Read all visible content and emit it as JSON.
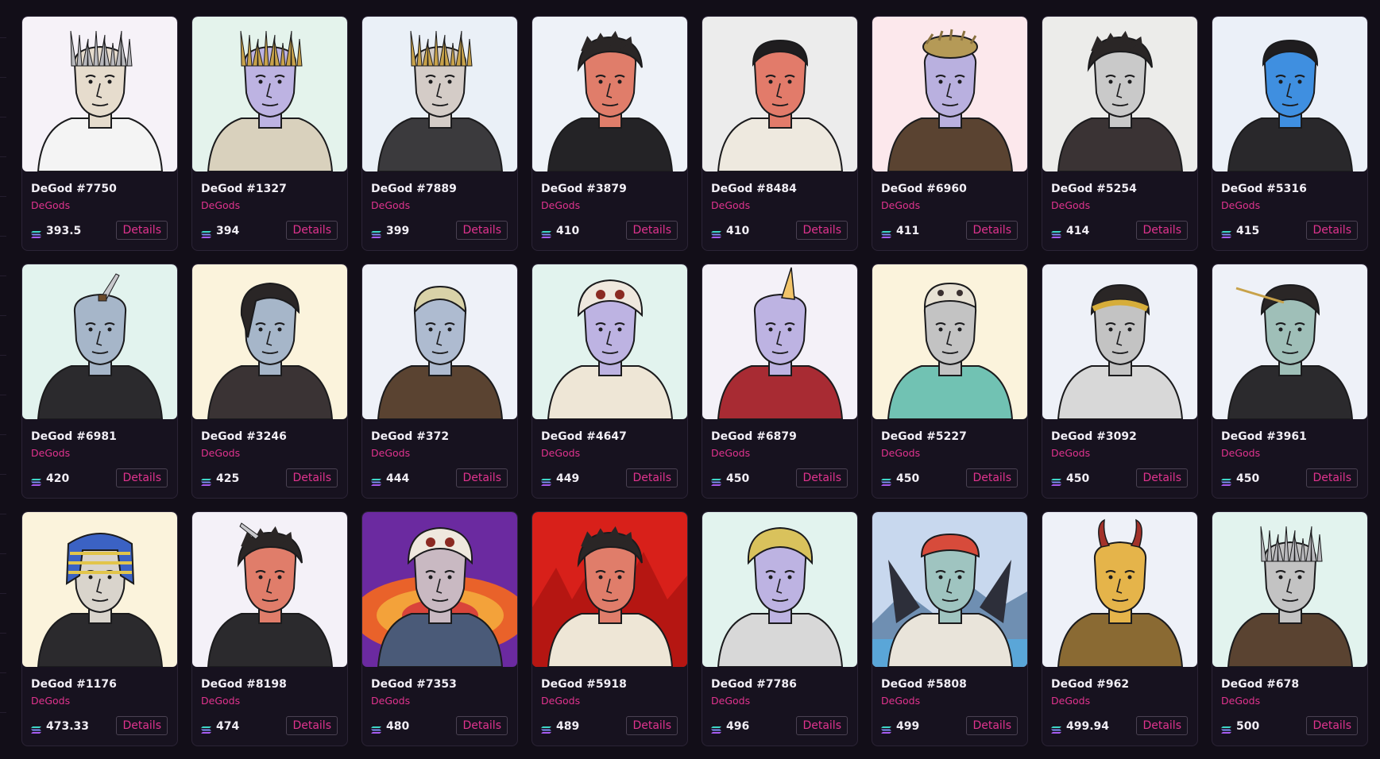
{
  "theme": {
    "page_bg": "#120e18",
    "card_bg": "#17121f",
    "accent": "#e0338e",
    "text": "#f1eef5",
    "sol_gradient": [
      "#9945ff",
      "#14f195"
    ]
  },
  "grid": {
    "details_label": "Details",
    "cards": [
      {
        "name": "DeGod #7750",
        "collection": "DeGods",
        "price": "393.5",
        "bg": "#f6f2f8",
        "skin": "#e6dccd",
        "hair": "spikes-silver",
        "outfit": "#f4f4f4"
      },
      {
        "name": "DeGod #1327",
        "collection": "DeGods",
        "price": "394",
        "bg": "#e4f3ec",
        "skin": "#bdb3e2",
        "hair": "spikes-gold",
        "outfit": "#d9d1bd"
      },
      {
        "name": "DeGod #7889",
        "collection": "DeGods",
        "price": "399",
        "bg": "#eaf0f7",
        "skin": "#d4ccc7",
        "hair": "spikes-gold",
        "outfit": "#3b3a3d"
      },
      {
        "name": "DeGod #3879",
        "collection": "DeGods",
        "price": "410",
        "bg": "#eef2f8",
        "skin": "#e07d6a",
        "hair": "messy-dark",
        "outfit": "#242326"
      },
      {
        "name": "DeGod #8484",
        "collection": "DeGods",
        "price": "410",
        "bg": "#ececec",
        "skin": "#e27b6a",
        "hair": "short-dark",
        "outfit": "#eee9df"
      },
      {
        "name": "DeGod #6960",
        "collection": "DeGods",
        "price": "411",
        "bg": "#fce8ec",
        "skin": "#b9b0df",
        "hair": "nest",
        "outfit": "#5a4331"
      },
      {
        "name": "DeGod #5254",
        "collection": "DeGods",
        "price": "414",
        "bg": "#ececea",
        "skin": "#c9c9c9",
        "hair": "messy-dark",
        "outfit": "#3a3334"
      },
      {
        "name": "DeGod #5316",
        "collection": "DeGods",
        "price": "415",
        "bg": "#ebf0f8",
        "skin": "#3f8fe0",
        "hair": "short-dark",
        "outfit": "#29282b"
      },
      {
        "name": "DeGod #6981",
        "collection": "DeGods",
        "price": "420",
        "bg": "#e2f3ee",
        "skin": "#a6b6c9",
        "hair": "knife",
        "outfit": "#2b2a2d"
      },
      {
        "name": "DeGod #3246",
        "collection": "DeGods",
        "price": "425",
        "bg": "#fbf3dc",
        "skin": "#a6b6c9",
        "hair": "mullet",
        "outfit": "#3a3334"
      },
      {
        "name": "DeGod #372",
        "collection": "DeGods",
        "price": "444",
        "bg": "#eef1f8",
        "skin": "#aebbd0",
        "hair": "buzz-blonde",
        "outfit": "#5a4331"
      },
      {
        "name": "DeGod #4647",
        "collection": "DeGods",
        "price": "449",
        "bg": "#e2f3ee",
        "skin": "#bdb3e2",
        "hair": "skull",
        "outfit": "#eee6d6"
      },
      {
        "name": "DeGod #6879",
        "collection": "DeGods",
        "price": "450",
        "bg": "#f4f1f8",
        "skin": "#bdb3e2",
        "hair": "unicorn",
        "outfit": "#a82b33"
      },
      {
        "name": "DeGod #5227",
        "collection": "DeGods",
        "price": "450",
        "bg": "#fbf3dc",
        "skin": "#c3c3c3",
        "hair": "mask",
        "outfit": "#71c2b3"
      },
      {
        "name": "DeGod #3092",
        "collection": "DeGods",
        "price": "450",
        "bg": "#eef1f8",
        "skin": "#c3c3c3",
        "hair": "laurel",
        "outfit": "#d8d8d8"
      },
      {
        "name": "DeGod #3961",
        "collection": "DeGods",
        "price": "450",
        "bg": "#eef1f8",
        "skin": "#9fbfb8",
        "hair": "arrow",
        "outfit": "#2b2a2d"
      },
      {
        "name": "DeGod #1176",
        "collection": "DeGods",
        "price": "473.33",
        "bg": "#fbf3dc",
        "skin": "#d9d4cc",
        "hair": "pharaoh",
        "outfit": "#2b2a2d"
      },
      {
        "name": "DeGod #8198",
        "collection": "DeGods",
        "price": "474",
        "bg": "#f4f1f8",
        "skin": "#e07d6a",
        "hair": "knife-dark",
        "outfit": "#2b2a2d"
      },
      {
        "name": "DeGod #7353",
        "collection": "DeGods",
        "price": "480",
        "bg": "#d9443a",
        "skin": "#c9b9c2",
        "hair": "skull",
        "outfit": "#4a5a78"
      },
      {
        "name": "DeGod #5918",
        "collection": "DeGods",
        "price": "489",
        "bg": "#e2241a",
        "skin": "#e07d6a",
        "hair": "messy-dark",
        "outfit": "#eee6d6"
      },
      {
        "name": "DeGod #7786",
        "collection": "DeGods",
        "price": "496",
        "bg": "#e2f3ee",
        "skin": "#bdb3e2",
        "hair": "curly-blonde",
        "outfit": "#d8d8d8"
      },
      {
        "name": "DeGod #5808",
        "collection": "DeGods",
        "price": "499",
        "bg": "#9ec3e6",
        "skin": "#9fc4c0",
        "hair": "bandana",
        "outfit": "#e9e4da"
      },
      {
        "name": "DeGod #962",
        "collection": "DeGods",
        "price": "499.94",
        "bg": "#eef1f8",
        "skin": "#e5b44a",
        "hair": "horns",
        "outfit": "#8a6a33"
      },
      {
        "name": "DeGod #678",
        "collection": "DeGods",
        "price": "500",
        "bg": "#e2f3ee",
        "skin": "#c3c3c3",
        "hair": "spikes-silver",
        "outfit": "#5a4331"
      }
    ]
  }
}
